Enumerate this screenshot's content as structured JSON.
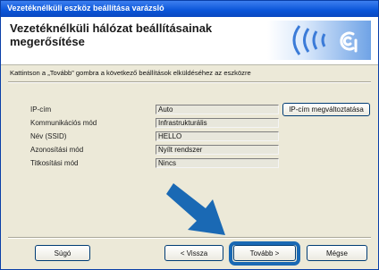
{
  "window": {
    "title": "Vezetéknélküli eszköz beállítása varázsló"
  },
  "header": {
    "heading": "Vezetéknélküli hálózat beállításainak megerősítése"
  },
  "instruction": "Kattintson a „Tovább” gombra a következő beállítások elküldéséhez az eszközre",
  "settings": [
    {
      "label": "IP-cím",
      "value": "Auto"
    },
    {
      "label": "Kommunikációs mód",
      "value": "Infrastrukturális"
    },
    {
      "label": "Név (SSID)",
      "value": "HELLO"
    },
    {
      "label": "Azonosítási mód",
      "value": "Nyílt rendszer"
    },
    {
      "label": "Titkosítási mód",
      "value": "Nincs"
    }
  ],
  "buttons": {
    "change_ip": "IP-cím megváltoztatása",
    "help": "Súgó",
    "back": "< Vissza",
    "next": "Tovább >",
    "cancel": "Mégse"
  },
  "colors": {
    "title_bar": "#0a55d8",
    "highlight": "#1a69b4",
    "arrow": "#1a69b4"
  },
  "icons": {
    "logo": "wireless-signal-icon",
    "arrow": "down-right-arrow-icon"
  }
}
